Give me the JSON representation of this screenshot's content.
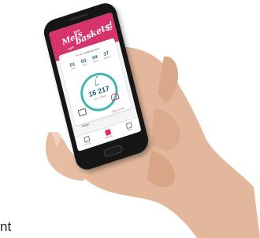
{
  "app": {
    "logo_line1": "Mets",
    "logo_line2": "tes",
    "logo_line3": "ton",
    "logo_line4": "baskets!",
    "countdown_title": "Fin du challenge dans",
    "countdown": [
      {
        "value": "01",
        "unit": "Mois"
      },
      {
        "value": "03",
        "unit": "Jours"
      },
      {
        "value": "04",
        "unit": "Heures"
      },
      {
        "value": "37",
        "unit": "Minutes"
      }
    ],
    "steps_value": "16 217",
    "steps_unit": "sur 1 million",
    "left_link": "Pédigo",
    "right_link": "Faire un don",
    "tabs": [
      {
        "label": "Accueil",
        "active": false
      },
      {
        "label": "Mes pas",
        "active": true
      },
      {
        "label": "Profil",
        "active": false
      }
    ]
  },
  "caption": "nt",
  "colors": {
    "brand_pink": "#d6336c",
    "teal": "#45b5b3",
    "navy": "#1f5f7a"
  }
}
